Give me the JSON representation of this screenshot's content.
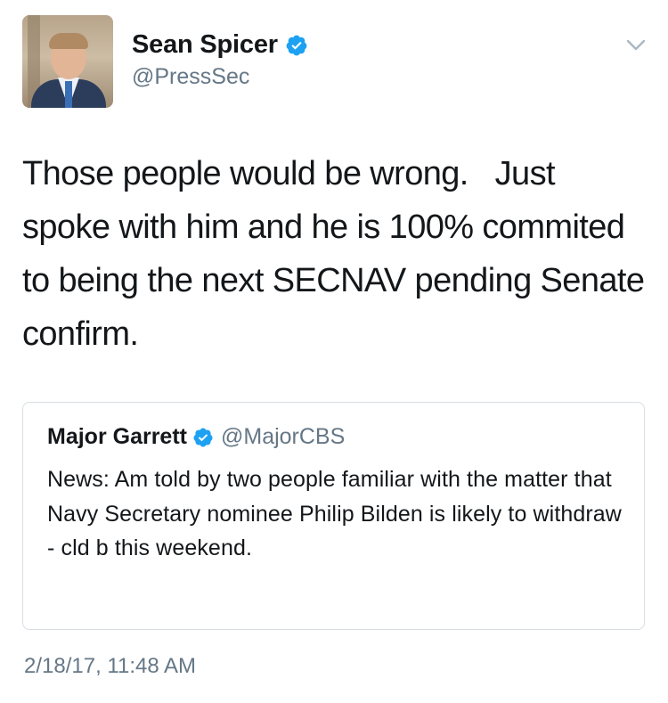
{
  "author": {
    "display_name": "Sean Spicer",
    "handle": "@PressSec",
    "verified": true,
    "avatar_icon": "profile-photo"
  },
  "tweet": {
    "text": "Those people would be wrong.   Just spoke with him and he is 100% commited to being the next SECNAV pending Senate confirm.",
    "timestamp": "2/18/17, 11:48 AM"
  },
  "quoted_tweet": {
    "display_name": "Major Garrett",
    "handle": "@MajorCBS",
    "verified": true,
    "text": "News: Am told by two people familiar with the matter that Navy Secretary nominee Philip Bilden is likely to withdraw - cld b this weekend."
  },
  "colors": {
    "verified_blue": "#1da1f2",
    "secondary_text": "#657786",
    "border": "#d8dee3"
  },
  "icons": {
    "verified": "verified-badge-icon",
    "menu": "chevron-down-icon"
  }
}
